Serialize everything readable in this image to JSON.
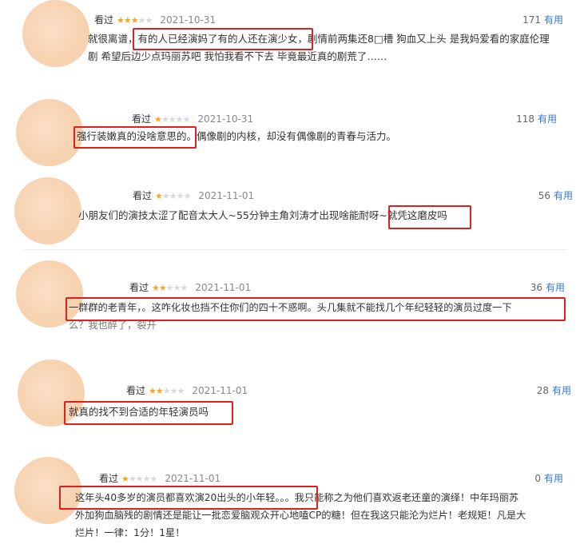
{
  "reviews": [
    {
      "seen_label": "看过",
      "stars_on": "★★★",
      "stars_off": "★★",
      "date": "2021-10-31",
      "useful_count": "171",
      "useful_label": "有用",
      "text_line1": "就很离谱，有的人已经演妈了有的人还在演少女，剧情前两集还8□槽 狗血又上头 是我妈爱看的家庭伦理",
      "text_line2": "剧 希望后边少点玛丽苏吧 我怕我看不下去 毕竟最近真的剧荒了……"
    },
    {
      "seen_label": "看过",
      "stars_on": "★",
      "stars_off": "★★★★",
      "date": "2021-10-31",
      "useful_count": "118",
      "useful_label": "有用",
      "text_line1": "强行装嫩真的没啥意思的。偶像剧的内核，却没有偶像剧的青春与活力。"
    },
    {
      "seen_label": "看过",
      "stars_on": "★",
      "stars_off": "★★★★",
      "date": "2021-11-01",
      "useful_count": "56",
      "useful_label": "有用",
      "text_line1": "小朋友们的演技太涩了配音太大人~55分钟主角刘涛才出现啥能耐呀~就凭这磨皮吗"
    },
    {
      "seen_label": "看过",
      "stars_on": "★★",
      "stars_off": "★★★",
      "date": "2021-11-01",
      "useful_count": "36",
      "useful_label": "有用",
      "text_line1": "一群群的老青年，。这咋化妆也挡不住你们的四十不惑啊。头几集就不能找几个年纪轻轻的演员过度一下",
      "text_line2": "么？我也醉了，裂开"
    },
    {
      "seen_label": "看过",
      "stars_on": "★★",
      "stars_off": "★★★",
      "date": "2021-11-01",
      "useful_count": "28",
      "useful_label": "有用",
      "text_line1": "就真的找不到合适的年轻演员吗"
    },
    {
      "seen_label": "看过",
      "stars_on": "★",
      "stars_off": "★★★★",
      "date": "2021-11-01",
      "useful_count": "0",
      "useful_label": "有用",
      "text_line1": "这年头40多岁的演员都喜欢演20出头的小年轻。。。我只能称之为他们喜欢返老还童的演绎！中年玛丽苏",
      "text_line2": "外加狗血脑残的剧情还是能让一批恋爱脑观众开心地嗑CP的糖！但在我这只能沦为烂片！老规矩！凡是大",
      "text_line3": "烂片！一律：1分！1星！"
    }
  ],
  "colors": {
    "highlight": "#e02020",
    "star_on": "#f6a623",
    "useful_link": "#3478c8",
    "avatar": "#f7d3b2"
  }
}
